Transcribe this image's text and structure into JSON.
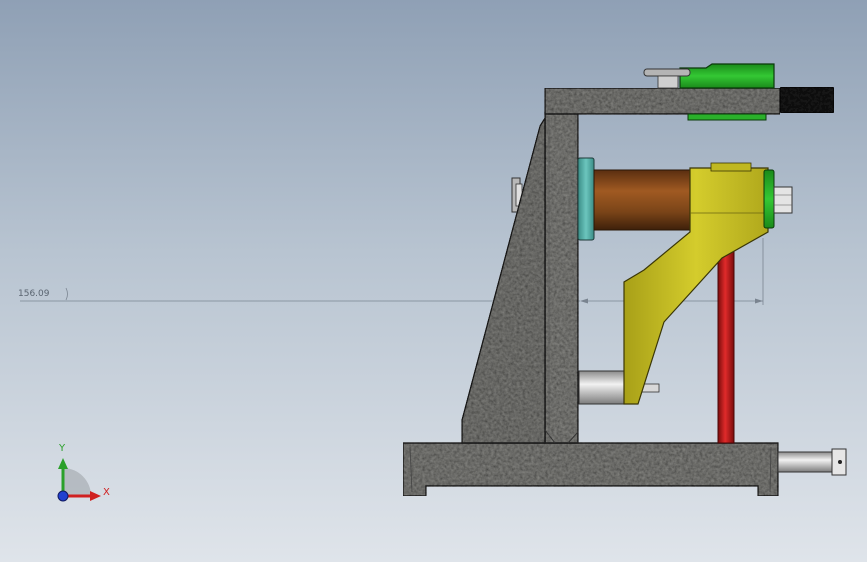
{
  "viewport": {
    "background_top": "#8fa0b5",
    "background_bottom": "#dfe4ea"
  },
  "dimension": {
    "text": "156.09"
  },
  "triad": {
    "x_label": "X",
    "y_label": "Y",
    "x_color": "#d02020",
    "y_color": "#2aa02a",
    "z_color": "#2040d0"
  },
  "parts": {
    "casting_color": "#8a8a86",
    "bushing_color": "#7a4418",
    "collar_color": "#4fa7a0",
    "lever_arm_color": "#c8c020",
    "rod_color": "#c01818",
    "clamp_color": "#2ab02a",
    "handle_color": "#1a1a1a",
    "pin_color": "#c8c8c8"
  }
}
